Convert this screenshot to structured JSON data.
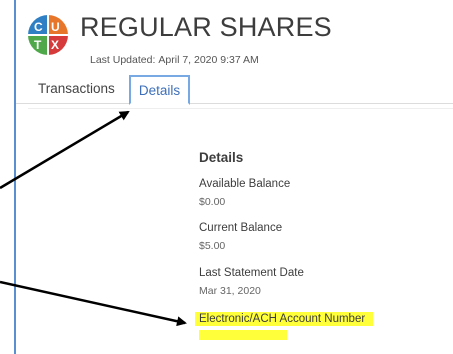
{
  "header": {
    "title": "REGULAR SHARES",
    "last_updated_label": "Last Updated:",
    "last_updated_value": "April 7, 2020 9:37 AM",
    "logo_letters": [
      "C",
      "U",
      "T",
      "X"
    ],
    "logo_colors": [
      "#2e7fc4",
      "#e8762a",
      "#4fa84a",
      "#d63a3a"
    ]
  },
  "tabs": [
    {
      "label": "Transactions",
      "active": false
    },
    {
      "label": "Details",
      "active": true
    }
  ],
  "details": {
    "heading": "Details",
    "fields": [
      {
        "label": "Available Balance",
        "value": "$0.00"
      },
      {
        "label": "Current Balance",
        "value": "$5.00"
      },
      {
        "label": "Last Statement Date",
        "value": "Mar 31, 2020"
      },
      {
        "label": "Electronic/ACH Account Number",
        "value": ""
      }
    ]
  },
  "annotations": {
    "arrow_color": "#000000",
    "highlight_color": "#ffff3a",
    "tab_accent": "#78a9e2"
  }
}
